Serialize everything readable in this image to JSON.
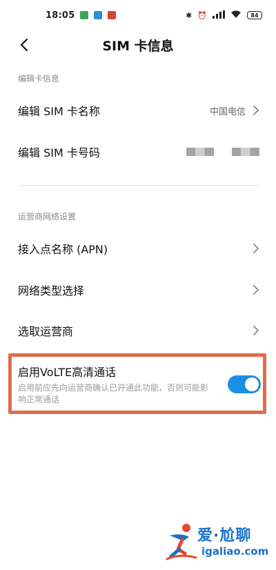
{
  "status_bar": {
    "time": "18:05",
    "battery": "84",
    "network": "HD"
  },
  "header": {
    "title": "SIM 卡信息"
  },
  "sections": {
    "card_info": {
      "label": "编辑卡信息",
      "sim_name_label": "编辑 SIM 卡名称",
      "sim_name_value": "中国电信",
      "sim_number_label": "编辑 SIM 卡号码"
    },
    "carrier": {
      "label": "运营商网络设置",
      "apn_label": "接入点名称 (APN)",
      "network_type_label": "网络类型选择",
      "select_carrier_label": "选取运营商"
    }
  },
  "volte": {
    "title": "启用VoLTE高清通话",
    "description": "启用前应先向运营商确认已开通此功能，否则可能影响正常通话",
    "enabled": true
  },
  "watermark": {
    "line1": "爱·尬聊",
    "line2": "igaliao.com"
  },
  "colors": {
    "accent": "#1a8fe3",
    "highlight": "#e06c4b",
    "watermark": "#1a73c8"
  }
}
